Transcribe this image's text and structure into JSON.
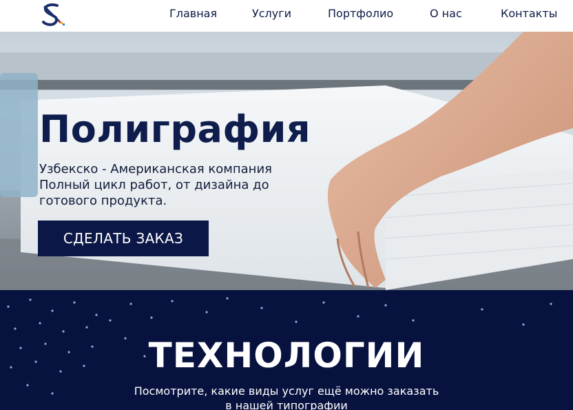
{
  "nav": {
    "items": [
      {
        "label": "Главная"
      },
      {
        "label": "Услуги"
      },
      {
        "label": "Портфолио"
      },
      {
        "label": "О нас"
      },
      {
        "label": "Контакты"
      }
    ]
  },
  "hero": {
    "title": "Полиграфия",
    "subtitle_lines": [
      "Узбекско - Американская компания",
      "Полный цикл работ, от дизайна до",
      "готового продукта."
    ],
    "button_label": "СДЕЛАТЬ ЗАКАЗ"
  },
  "technologies": {
    "title": "ТЕХНОЛОГИИ",
    "subtitle_lines": [
      "Посмотрите, какие виды услуг ещё можно заказать",
      "в нашей типографии"
    ]
  },
  "colors": {
    "brand_navy": "#0b1747",
    "section_bg": "#08123f",
    "text_dark": "#0f1d4d"
  },
  "icons": {
    "logo": "brand-logo-icon"
  }
}
